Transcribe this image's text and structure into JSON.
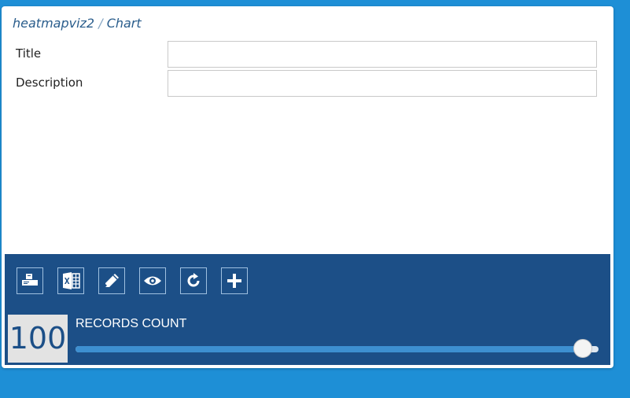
{
  "breadcrumb": {
    "parent": "heatmapviz2",
    "separator": "/",
    "current": "Chart"
  },
  "form": {
    "title_label": "Title",
    "title_value": "",
    "description_label": "Description",
    "description_value": ""
  },
  "toolbar": {
    "buttons": [
      {
        "icon": "print-icon"
      },
      {
        "icon": "excel-icon"
      },
      {
        "icon": "edit-icon"
      },
      {
        "icon": "view-icon"
      },
      {
        "icon": "refresh-icon"
      },
      {
        "icon": "add-icon"
      }
    ]
  },
  "records": {
    "count": "100",
    "label": "RECORDS COUNT",
    "slider_fraction": 0.97
  },
  "colors": {
    "background": "#1e8fd6",
    "panel": "#1c4f87",
    "slider_fill": "#3d8fd0"
  }
}
